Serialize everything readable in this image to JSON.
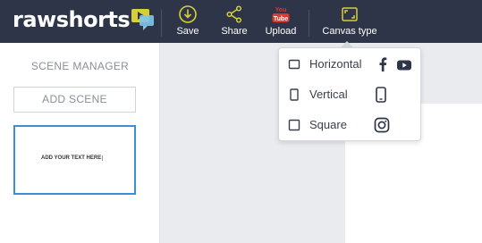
{
  "brand": {
    "name_part1": "raw",
    "name_part2": "shorts",
    "logo_icon": "chat-bubble-play-icon"
  },
  "toolbar": {
    "save_label": "Save",
    "share_label": "Share",
    "upload_label": "Upload",
    "upload_icon_text": "You Tube",
    "canvas_type_label": "Canvas type"
  },
  "sidebar": {
    "title": "SCENE MANAGER",
    "add_scene_label": "ADD SCENE",
    "scenes": [
      {
        "text": "ADD YOUR TEXT HERE",
        "selected": true
      }
    ]
  },
  "canvas_menu": {
    "options": [
      {
        "label": "Horizontal",
        "icons": [
          "facebook-icon",
          "youtube-icon"
        ]
      },
      {
        "label": "Vertical",
        "icons": [
          "phone-icon"
        ]
      },
      {
        "label": "Square",
        "icons": [
          "instagram-icon"
        ]
      }
    ]
  },
  "colors": {
    "topbar_bg": "#2e3548",
    "accent_yellow": "#d7cf3a",
    "youtube_red": "#d93a34",
    "selected_border": "#3b8fd6",
    "workspace_bg": "#e9ebef"
  }
}
